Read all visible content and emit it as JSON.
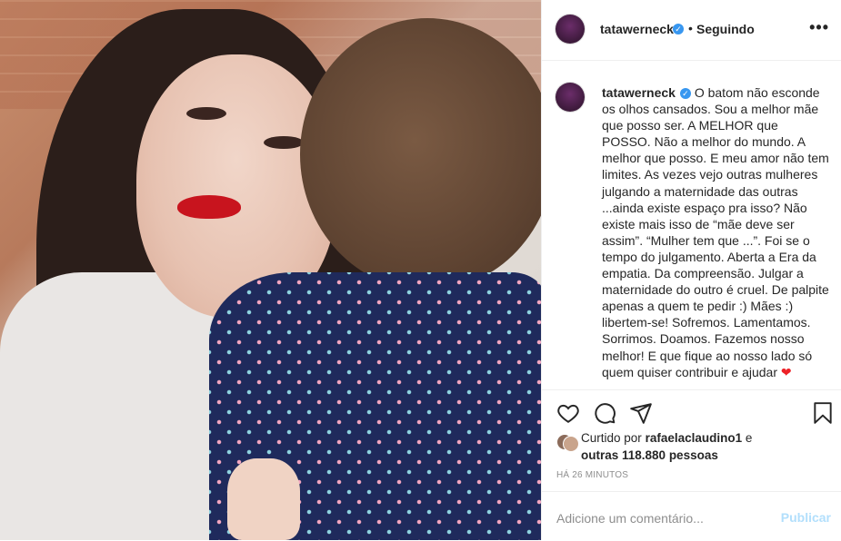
{
  "post": {
    "username": "tatawerneck",
    "verified_mark": "✓",
    "dot": "•",
    "follow_status": "Seguindo",
    "more_label": "•••",
    "photo_alt": "",
    "caption_text": "O batom não esconde os olhos cansados. Sou a melhor mãe que posso ser. A MELHOR que POSSO. Não a melhor do mundo. A melhor que posso. E meu amor não tem limites. As vezes vejo outras mulheres julgando a maternidade das outras ...ainda existe espaço pra isso? Não existe mais isso de “mãe deve ser assim”. “Mulher tem que ...”. Foi se o tempo do julgamento. Aberta a Era da empatia. Da compreensão. Julgar a maternidade do outro é cruel. De palpite apenas a quem te pedir :) Mães :) libertem-se! Sofremos. Lamentamos. Sorrimos. Doamos. Fazemos nosso melhor! E que fique ao nosso lado só quem quiser contribuir e ajudar ",
    "caption_emoji": "❤",
    "likes_prefix": "Curtido por",
    "liked_by_user": "rafaelaclaudino1",
    "likes_joiner": "e",
    "likes_others": "outras 118.880 pessoas",
    "timestamp": "HÁ 26 MINUTOS",
    "comment_placeholder": "Adicione um comentário...",
    "publish_label": "Publicar"
  },
  "icons": [
    "like-icon",
    "comment-icon",
    "share-icon",
    "save-icon"
  ],
  "colors": {
    "verified": "#3897f0",
    "publish_disabled": "#b2dffc",
    "muted_text": "#8e8e8e",
    "heart": "#ed2127"
  }
}
